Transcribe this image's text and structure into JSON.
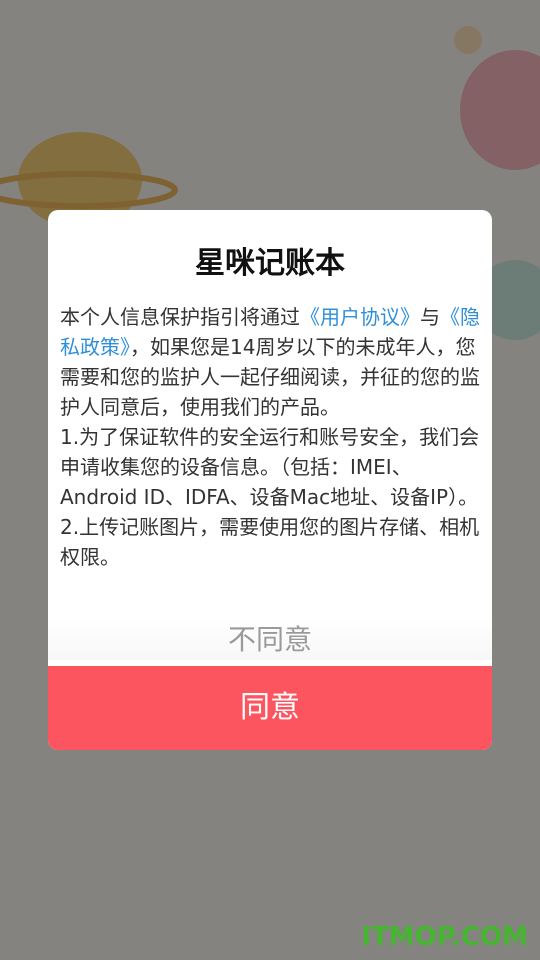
{
  "dialog": {
    "title": "星咪记账本",
    "body": {
      "p1_prefix": "本个人信息保护指引将通过",
      "link_user_agreement": "《用户协议》",
      "p1_and": "与",
      "link_privacy_policy": "《隐私政策》",
      "p1_suffix": "，如果您是14周岁以下的未成年人，您需要和您的监护人一起仔细阅读，并征的您的监护人同意后，使用我们的产品。",
      "item1": "1.为了保证软件的安全运行和账号安全，我们会申请收集您的设备信息。（包括：IMEI、Android ID、IDFA、设备Mac地址、设备IP）。",
      "item2": "2.上传记账图片，需要使用您的图片存储、相机权限。"
    },
    "disagree_label": "不同意",
    "agree_label": "同意"
  },
  "watermark": "ITMOP.COM",
  "colors": {
    "accent": "#fc5560",
    "link": "#2f8fd8",
    "watermark": "#46b52f"
  }
}
